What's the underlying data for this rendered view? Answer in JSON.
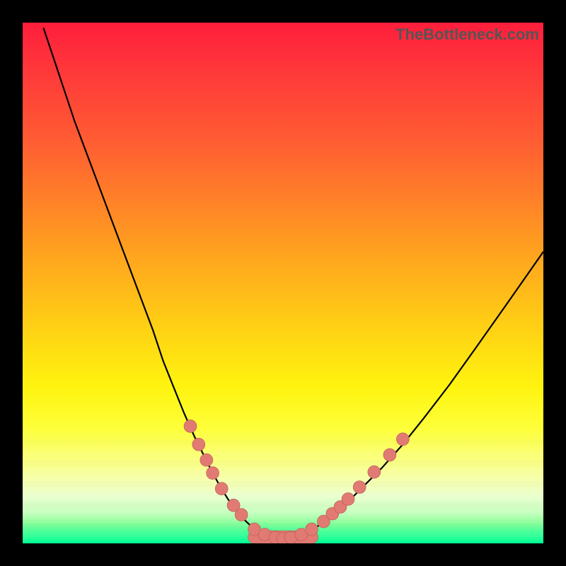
{
  "watermark": "TheBottleneck.com",
  "palette": {
    "curve_stroke": "#000000",
    "dot_fill": "#e07a72",
    "dot_stroke": "#b85a52",
    "frame_bg": "#000000"
  },
  "chart_data": {
    "type": "line",
    "title": "",
    "xlabel": "",
    "ylabel": "",
    "xlim": [
      0,
      100
    ],
    "ylim": [
      0,
      100
    ],
    "grid": false,
    "series": [
      {
        "name": "left-branch",
        "x": [
          4,
          6,
          8,
          10,
          13,
          16,
          19,
          22,
          25,
          27,
          29,
          31,
          33,
          35,
          36.5,
          38,
          39.5,
          41,
          42.5,
          44,
          45
        ],
        "y": [
          99,
          93,
          87,
          81,
          73,
          65,
          57,
          49,
          41,
          35,
          30,
          25,
          20.5,
          16.5,
          13.5,
          10.8,
          8.4,
          6.4,
          4.6,
          3.2,
          2.3
        ]
      },
      {
        "name": "valley-floor",
        "x": [
          45,
          46,
          47,
          48,
          49,
          50,
          51,
          52,
          53,
          54,
          55
        ],
        "y": [
          2.3,
          1.55,
          1.15,
          0.9,
          0.8,
          0.75,
          0.8,
          0.9,
          1.15,
          1.55,
          2.3
        ]
      },
      {
        "name": "right-branch",
        "x": [
          55,
          57,
          59,
          62,
          65,
          69,
          73,
          77,
          82,
          87,
          93,
          100
        ],
        "y": [
          2.3,
          3.5,
          5,
          7.5,
          10.5,
          14.5,
          19,
          24,
          30.5,
          37.5,
          46,
          56
        ]
      }
    ],
    "dots_left": [
      {
        "x": 32.2,
        "y": 22.5
      },
      {
        "x": 33.8,
        "y": 19
      },
      {
        "x": 35.3,
        "y": 16
      },
      {
        "x": 36.5,
        "y": 13.5
      },
      {
        "x": 38.2,
        "y": 10.5
      },
      {
        "x": 40.5,
        "y": 7.3
      },
      {
        "x": 42,
        "y": 5.5
      }
    ],
    "dots_right": [
      {
        "x": 57.8,
        "y": 4.2
      },
      {
        "x": 59.5,
        "y": 5.7
      },
      {
        "x": 61,
        "y": 7
      },
      {
        "x": 62.5,
        "y": 8.5
      },
      {
        "x": 64.7,
        "y": 10.8
      },
      {
        "x": 67.5,
        "y": 13.7
      },
      {
        "x": 70.5,
        "y": 17
      },
      {
        "x": 73,
        "y": 20
      }
    ],
    "dots_bottom": [
      {
        "x": 44.5,
        "y": 2.7
      },
      {
        "x": 46.5,
        "y": 1.7
      },
      {
        "x": 48.5,
        "y": 1.1
      },
      {
        "x": 50,
        "y": 0.9
      },
      {
        "x": 51.5,
        "y": 1.1
      },
      {
        "x": 53.5,
        "y": 1.7
      },
      {
        "x": 55.5,
        "y": 2.7
      }
    ]
  }
}
